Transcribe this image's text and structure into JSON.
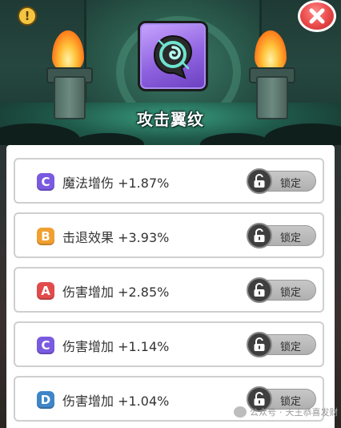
{
  "header": {
    "title": "攻击翼纹",
    "info_icon": "exclamation-icon",
    "close_icon": "close-x-icon"
  },
  "colors": {
    "grade_C": "#7a5ae0",
    "grade_B": "#f0a030",
    "grade_A": "#e24b4b",
    "grade_D": "#3f86c8"
  },
  "rows": [
    {
      "grade": "C",
      "text": "魔法增伤 +1.87%",
      "lock_label": "锁定"
    },
    {
      "grade": "B",
      "text": "击退效果 +3.93%",
      "lock_label": "锁定"
    },
    {
      "grade": "A",
      "text": "伤害增加 +2.85%",
      "lock_label": "锁定"
    },
    {
      "grade": "C",
      "text": "伤害增加 +1.14%",
      "lock_label": "锁定"
    },
    {
      "grade": "D",
      "text": "伤害增加 +1.04%",
      "lock_label": "锁定"
    }
  ],
  "watermark": {
    "source": "公众号",
    "name": "天王恭喜发财"
  }
}
